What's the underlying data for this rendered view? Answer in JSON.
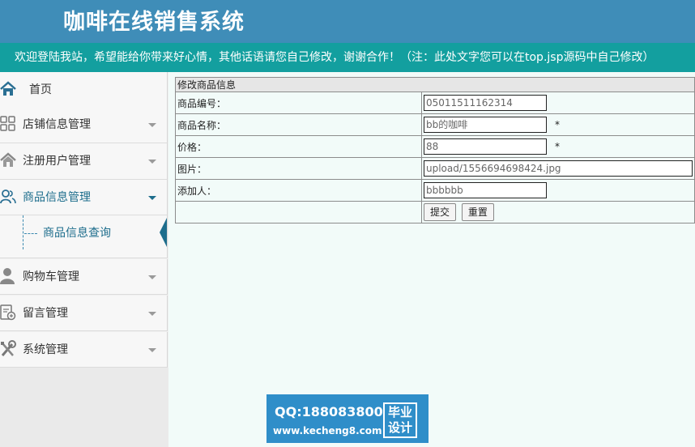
{
  "header": {
    "title": "咖啡在线销售系统"
  },
  "marquee": {
    "text": "欢迎登陆我站，希望能给你带来好心情，其他话语请您自己修改，谢谢合作！（注：此处文字您可以在top.jsp源码中自己修改）"
  },
  "sidebar": {
    "items": [
      {
        "label": "首页",
        "icon": "home-icon"
      },
      {
        "label": "店铺信息管理",
        "icon": "grid-icon"
      },
      {
        "label": "注册用户管理",
        "icon": "house-icon"
      },
      {
        "label": "商品信息管理",
        "icon": "users-icon"
      },
      {
        "label": "购物车管理",
        "icon": "person-icon"
      },
      {
        "label": "留言管理",
        "icon": "message-icon"
      },
      {
        "label": "系统管理",
        "icon": "tools-icon"
      }
    ],
    "submenu": {
      "label": "商品信息查询"
    }
  },
  "form": {
    "heading": "修改商品信息",
    "fields": [
      {
        "label": "商品编号：",
        "value": "05011511162314",
        "required": ""
      },
      {
        "label": "商品名称：",
        "value": "bb的咖啡",
        "required": "*"
      },
      {
        "label": "价格：",
        "value": "88",
        "required": "*"
      },
      {
        "label": "图片：",
        "value": "upload/1556694698424.jpg",
        "required": ""
      },
      {
        "label": "添加人：",
        "value": "bbbbbb",
        "required": ""
      }
    ],
    "submit_label": "提交",
    "reset_label": "重置"
  },
  "watermark": {
    "qq": "QQ:188083800",
    "site": "www.kecheng8.com",
    "badge_line1": "毕业",
    "badge_line2": "设计"
  },
  "colors": {
    "header_bg": "#3f8db8",
    "marquee_bg": "#139f9f",
    "accent": "#1d6d8c"
  }
}
